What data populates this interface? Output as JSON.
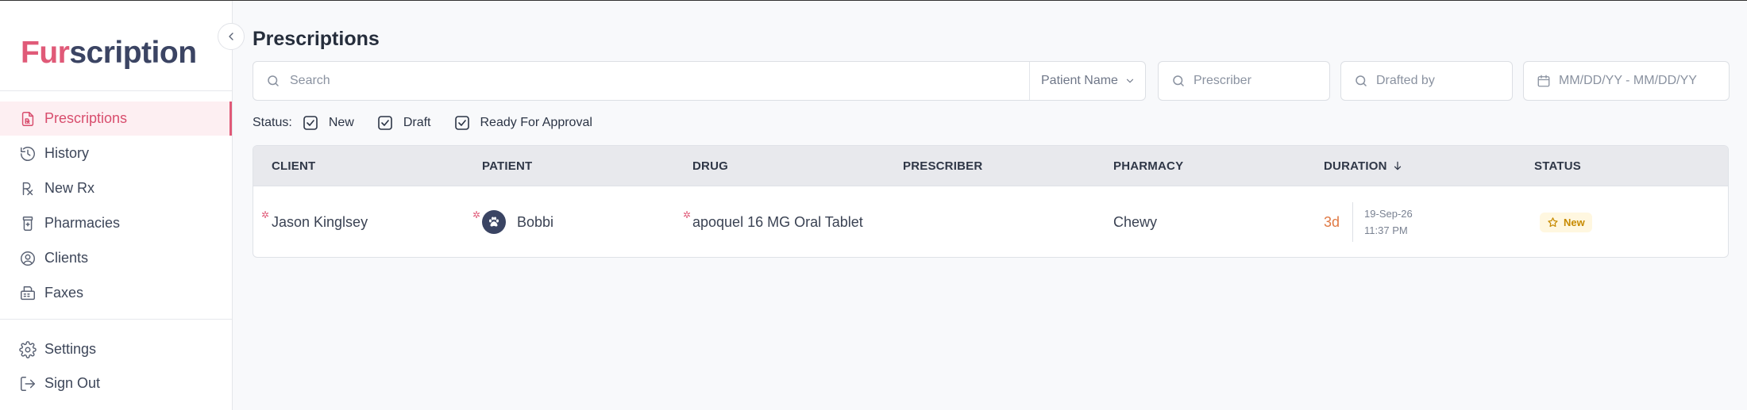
{
  "app": {
    "logo_part1": "Fur",
    "logo_part2": "scription"
  },
  "sidebar": {
    "items": [
      {
        "label": "Prescriptions",
        "icon": "prescription-doc-icon",
        "active": true
      },
      {
        "label": "History",
        "icon": "history-icon"
      },
      {
        "label": "New Rx",
        "icon": "rx-icon"
      },
      {
        "label": "Pharmacies",
        "icon": "pharmacy-icon"
      },
      {
        "label": "Clients",
        "icon": "user-circle-icon"
      },
      {
        "label": "Faxes",
        "icon": "fax-icon"
      }
    ],
    "bottom": [
      {
        "label": "Settings",
        "icon": "gear-icon"
      },
      {
        "label": "Sign Out",
        "icon": "sign-out-icon"
      }
    ]
  },
  "page": {
    "title": "Prescriptions"
  },
  "filters": {
    "search_placeholder": "Search",
    "search_by": "Patient Name",
    "prescriber_placeholder": "Prescriber",
    "drafted_by_placeholder": "Drafted by",
    "date_placeholder": "MM/DD/YY - MM/DD/YY"
  },
  "status_filter": {
    "label": "Status:",
    "options": [
      {
        "label": "New",
        "checked": true
      },
      {
        "label": "Draft",
        "checked": true
      },
      {
        "label": "Ready For Approval",
        "checked": true
      }
    ]
  },
  "table": {
    "columns": [
      "CLIENT",
      "PATIENT",
      "DRUG",
      "PRESCRIBER",
      "PHARMACY",
      "DURATION",
      "STATUS"
    ],
    "sorted_column": "DURATION",
    "rows": [
      {
        "client": "Jason Kinglsey",
        "patient": "Bobbi",
        "drug": "apoquel 16 MG Oral Tablet",
        "prescriber": "",
        "pharmacy": "Chewy",
        "duration": "3d",
        "date": "19-Sep-26",
        "time": "11:37 PM",
        "status": "New"
      }
    ]
  },
  "colors": {
    "accent": "#e05a78",
    "brand_dark": "#3b4463",
    "duration": "#e07a45",
    "status_new_bg": "#fff7e0",
    "status_new_fg": "#c78a00"
  }
}
